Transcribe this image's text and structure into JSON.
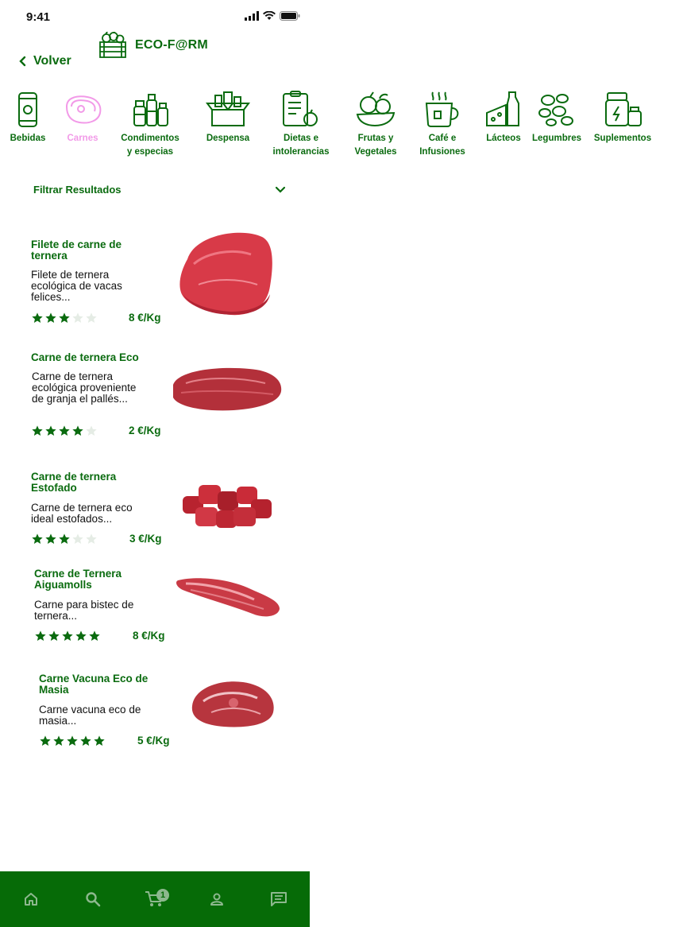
{
  "status": {
    "time": "9:41"
  },
  "header": {
    "back_label": "Volver",
    "brand": "ECO-F@RM"
  },
  "categories": [
    {
      "label": "Bebidas",
      "icon": "can-icon",
      "active": false
    },
    {
      "label": "Carnes",
      "icon": "meat-icon",
      "active": true
    },
    {
      "label": "Condimentos\ny especias",
      "icon": "spice-jars-icon",
      "active": false
    },
    {
      "label": "Despensa",
      "icon": "pantry-box-icon",
      "active": false
    },
    {
      "label": "Dietas e\nintolerancias",
      "icon": "diet-clipboard-icon",
      "active": false
    },
    {
      "label": "Frutas y\nVegetales",
      "icon": "fruit-basket-icon",
      "active": false
    },
    {
      "label": "Café e\nInfusiones",
      "icon": "tea-cup-icon",
      "active": false
    },
    {
      "label": "Lácteos",
      "icon": "dairy-icon",
      "active": false
    },
    {
      "label": "Legumbres",
      "icon": "beans-icon",
      "active": false
    },
    {
      "label": "Suplementos",
      "icon": "supplement-icon",
      "active": false
    }
  ],
  "filter": {
    "label": "Filtrar Resultados"
  },
  "products": [
    {
      "title": "Filete de carne de\nternera",
      "description": "Filete de ternera\necológica de vacas\nfelices...",
      "rating": 3,
      "price": "8 €/Kg"
    },
    {
      "title": "Carne de ternera Eco",
      "description": "Carne de ternera\necológica proveniente\nde granja el pallés...",
      "rating": 4,
      "price": "2 €/Kg"
    },
    {
      "title": "Carne de ternera\nEstofado",
      "description": "Carne de ternera eco\nideal estofados...",
      "rating": 3,
      "price": "3 €/Kg"
    },
    {
      "title": "Carne de Ternera\nAiguamolls",
      "description": "Carne para bistec de\nternera...",
      "rating": 5,
      "price": "8 €/Kg"
    },
    {
      "title": "Carne Vacuna Eco de\nMasia",
      "description": "Carne vacuna eco de\nmasia...",
      "rating": 5,
      "price": "5 €/Kg"
    }
  ],
  "nav": {
    "items": [
      {
        "icon": "home-icon"
      },
      {
        "icon": "search-icon"
      },
      {
        "icon": "cart-icon"
      },
      {
        "icon": "user-icon"
      },
      {
        "icon": "chat-icon"
      }
    ],
    "cart_count": "1"
  },
  "colors": {
    "brand_green": "#0a6b0f",
    "nav_green": "#066b07",
    "active_pink": "#f29ae8"
  }
}
